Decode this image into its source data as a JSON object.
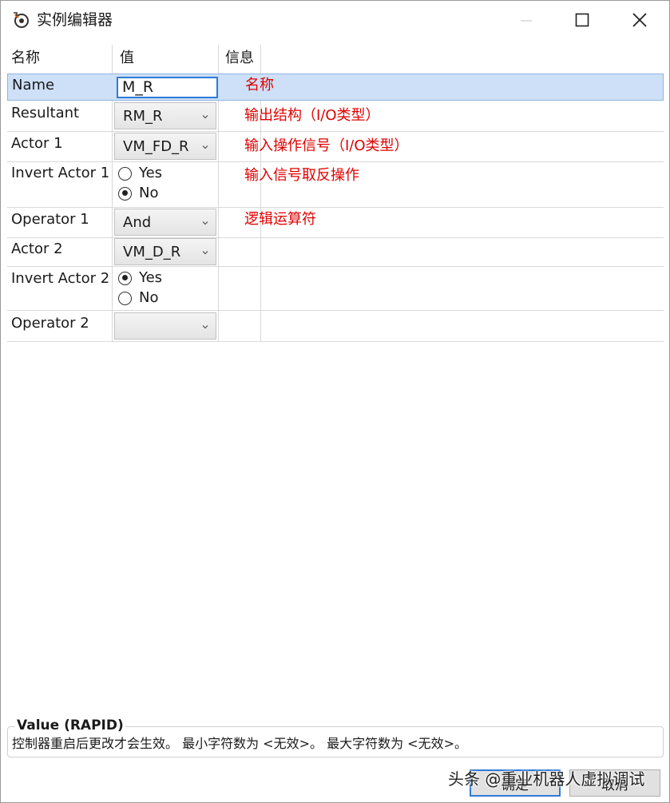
{
  "window": {
    "title": "实例编辑器",
    "icon": "rapid-gear-icon"
  },
  "grid": {
    "headers": {
      "name": "名称",
      "value": "值",
      "info": "信息"
    },
    "rows": [
      {
        "name": "Name",
        "value": "M_R",
        "info": "名称"
      },
      {
        "name": "Resultant",
        "value": "RM_R",
        "info": "输出结构（I/O类型）"
      },
      {
        "name": "Actor 1",
        "value": "VM_FD_R",
        "info": "输入操作信号（I/O类型）"
      },
      {
        "name": "Invert Actor 1",
        "yes": "Yes",
        "no": "No",
        "selected": "No",
        "info": "输入信号取反操作"
      },
      {
        "name": "Operator 1",
        "value": "And",
        "info": "逻辑运算符"
      },
      {
        "name": "Actor 2",
        "value": "VM_D_R",
        "info": ""
      },
      {
        "name": "Invert Actor 2",
        "yes": "Yes",
        "no": "No",
        "selected": "Yes",
        "info": ""
      },
      {
        "name": "Operator 2",
        "value": "",
        "info": ""
      }
    ]
  },
  "footer": {
    "title": "Value (RAPID)",
    "text": "控制器重启后更改才会生效。 最小字符数为 <无效>。 最大字符数为 <无效>。"
  },
  "buttons": {
    "ok": "确定",
    "cancel": "取消"
  },
  "watermark": "头条 @重业机器人虚拟调试",
  "colors": {
    "annotation": "#e00000",
    "selection": "#cde0f7",
    "focus": "#2f7bd8"
  }
}
